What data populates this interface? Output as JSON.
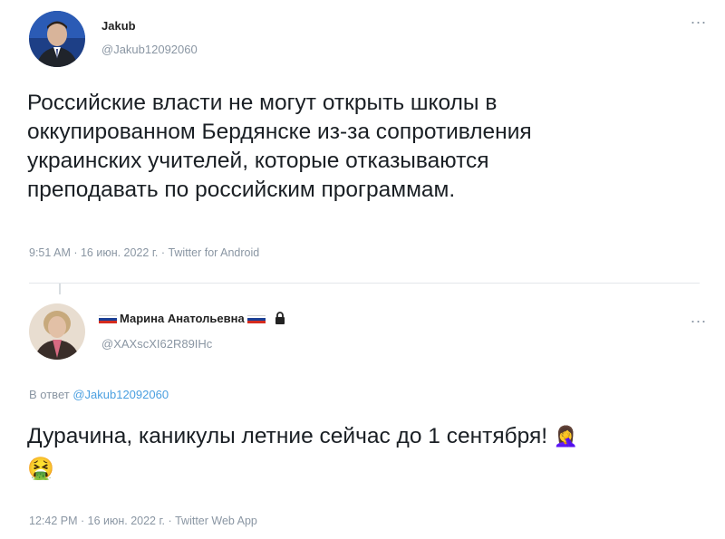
{
  "tweet1": {
    "author_name": "Jakub",
    "author_handle": "@Jakub12092060",
    "more_label": "...",
    "text_lines": [
      "Российские власти не могут открыть школы в",
      "оккупированном Бердянске из-за сопротивления",
      "украинских учителей, которые отказываются",
      "преподавать по российским программам."
    ],
    "timestamp": "9:51 AM · 16 июн. 2022 г. · Twitter for Android"
  },
  "tweet2": {
    "author_name": "Марина Анатольевна",
    "author_handle": "@XAXscXI62R89IHc",
    "more_label": "...",
    "reply_prefix": "В ответ",
    "reply_handle": "@Jakub12092060",
    "text_line1": "Дурачина, каникулы летние сейчас до 1 сентября!",
    "emoji_facepalm": "🤦‍♀️",
    "emoji_vomit": "🤮",
    "timestamp": "12:42 PM · 16 июн. 2022 г. · Twitter Web App"
  },
  "colors": {
    "flag_white": "#ffffff",
    "flag_blue": "#1c3f94",
    "flag_red": "#d52b1e",
    "link": "#4a9fe0",
    "meta_grey": "#8a96a3"
  },
  "icons": [
    "avatar-jakub",
    "avatar-marina",
    "more-icon",
    "russian-flag-icon",
    "lock-icon",
    "facepalm-emoji",
    "vomit-emoji"
  ]
}
